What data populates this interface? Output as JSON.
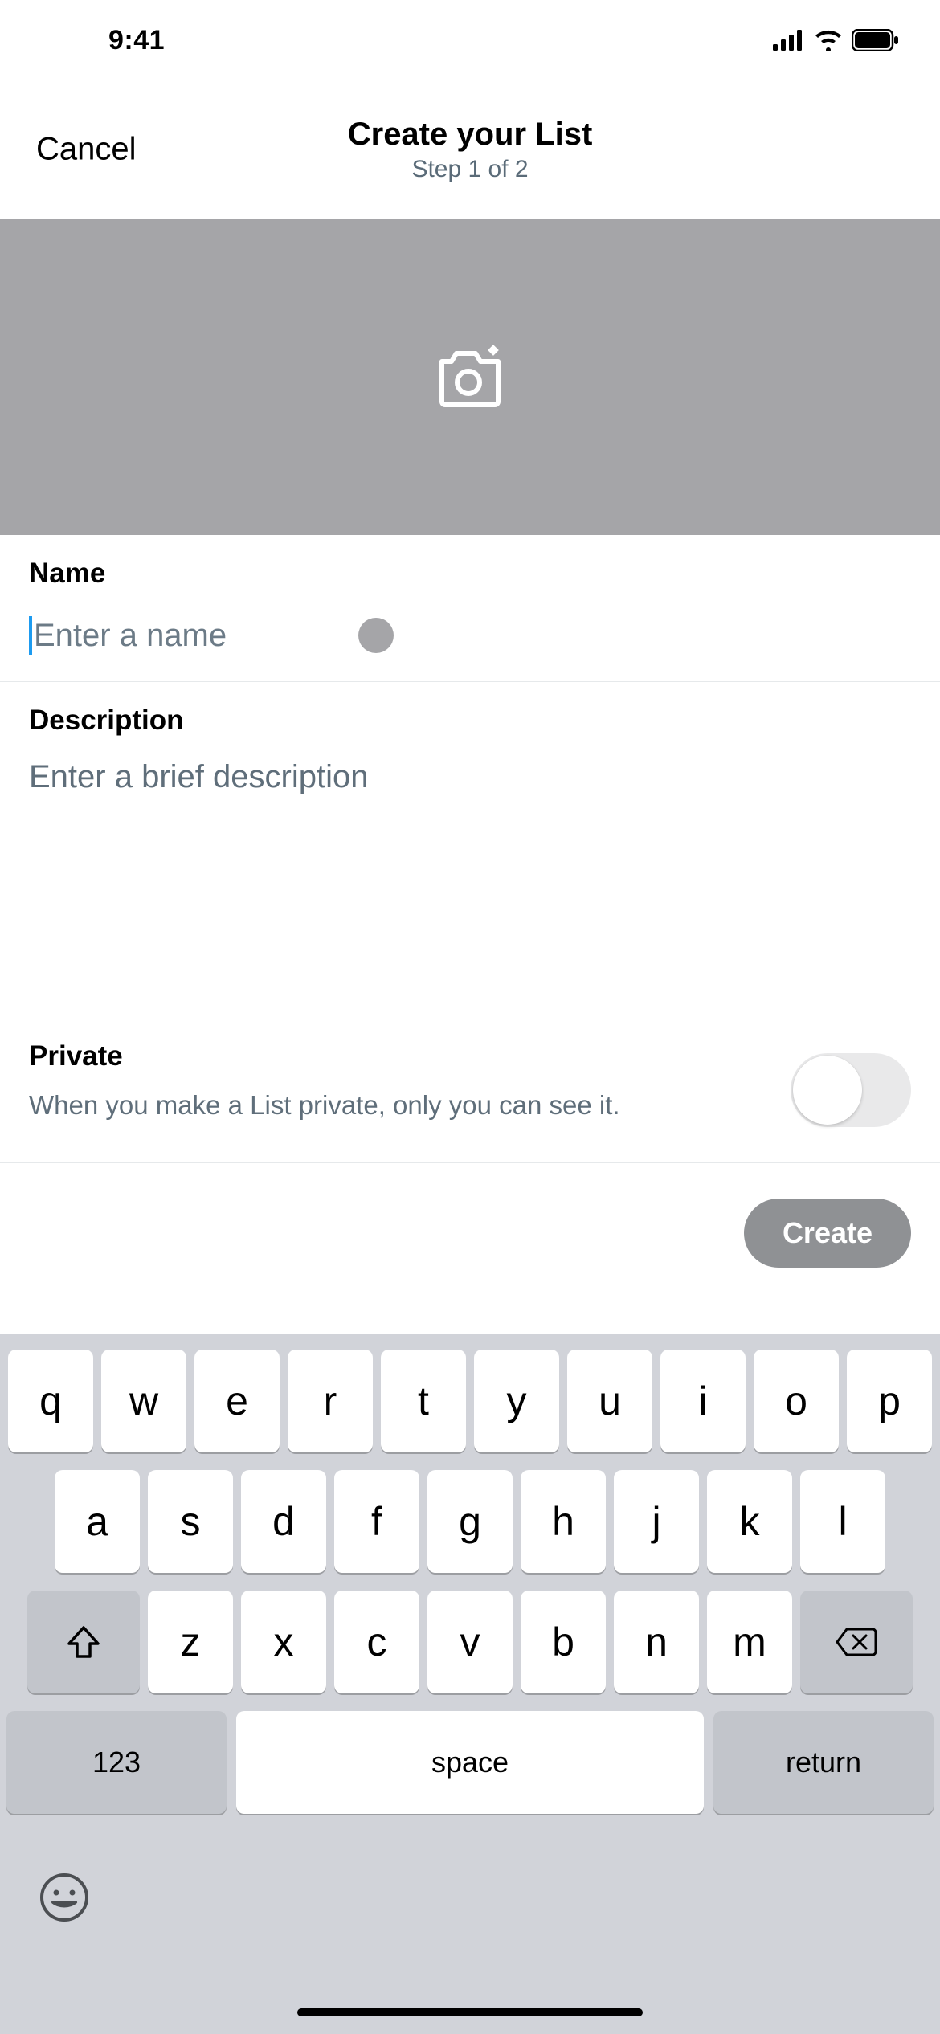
{
  "status": {
    "time": "9:41"
  },
  "header": {
    "cancel": "Cancel",
    "title": "Create your List",
    "subtitle": "Step 1 of 2"
  },
  "form": {
    "name_label": "Name",
    "name_placeholder": "Enter a name",
    "name_value": "",
    "description_label": "Description",
    "description_placeholder": "Enter a brief description",
    "description_value": "",
    "private_label": "Private",
    "private_desc": "When you make a List private, only you can see it.",
    "private_on": false,
    "create_label": "Create"
  },
  "keyboard": {
    "row1": [
      "q",
      "w",
      "e",
      "r",
      "t",
      "y",
      "u",
      "i",
      "o",
      "p"
    ],
    "row2": [
      "a",
      "s",
      "d",
      "f",
      "g",
      "h",
      "j",
      "k",
      "l"
    ],
    "row3": [
      "z",
      "x",
      "c",
      "v",
      "b",
      "n",
      "m"
    ],
    "numbers_label": "123",
    "space_label": "space",
    "return_label": "return"
  }
}
